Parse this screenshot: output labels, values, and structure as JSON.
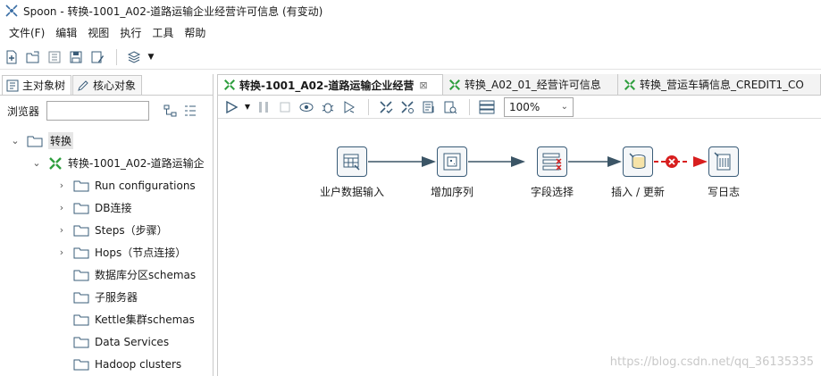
{
  "window": {
    "title": "Spoon - 转换-1001_A02-道路运输企业经营许可信息 (有变动)"
  },
  "menu": [
    "文件(F)",
    "编辑",
    "视图",
    "执行",
    "工具",
    "帮助"
  ],
  "main_toolbar": {
    "icons": [
      "new-file-icon",
      "open-folder-icon",
      "explore-repository-icon",
      "save-icon",
      "save-as-icon",
      "perspective-layers-icon"
    ]
  },
  "left_panel": {
    "tabs": [
      {
        "label": "主对象树",
        "icon": "tree-icon",
        "active": true
      },
      {
        "label": "核心对象",
        "icon": "pencil-icon",
        "active": false
      }
    ],
    "browser_label": "浏览器",
    "search_value": "",
    "tree": [
      {
        "label": "转换",
        "level": 0,
        "expanded": true,
        "icon": "folder-icon",
        "selected": true
      },
      {
        "label": "转换-1001_A02-道路运输企",
        "level": 1,
        "expanded": true,
        "icon": "transformation-icon"
      },
      {
        "label": "Run configurations",
        "level": 2,
        "expandable": true,
        "icon": "folder-icon"
      },
      {
        "label": "DB连接",
        "level": 2,
        "expandable": true,
        "icon": "folder-icon"
      },
      {
        "label": "Steps（步骤）",
        "level": 2,
        "expandable": true,
        "icon": "folder-icon"
      },
      {
        "label": "Hops（节点连接）",
        "level": 2,
        "expandable": true,
        "icon": "folder-icon"
      },
      {
        "label": "数据库分区schemas",
        "level": 2,
        "expandable": false,
        "icon": "folder-icon"
      },
      {
        "label": "子服务器",
        "level": 2,
        "expandable": false,
        "icon": "folder-icon"
      },
      {
        "label": "Kettle集群schemas",
        "level": 2,
        "expandable": false,
        "icon": "folder-icon"
      },
      {
        "label": "Data Services",
        "level": 2,
        "expandable": false,
        "icon": "folder-icon"
      },
      {
        "label": "Hadoop clusters",
        "level": 2,
        "expandable": false,
        "icon": "folder-icon"
      }
    ]
  },
  "editor": {
    "tabs": [
      {
        "label": "转换-1001_A02-道路运输企业经营",
        "active": true,
        "closable": true
      },
      {
        "label": "转换_A02_01_经营许可信息",
        "active": false
      },
      {
        "label": "转换_营运车辆信息_CREDIT1_CO",
        "active": false
      }
    ],
    "zoom": "100%",
    "steps": [
      {
        "label": "业户数据输入",
        "icon": "table-input-icon"
      },
      {
        "label": "增加序列",
        "icon": "add-sequence-icon"
      },
      {
        "label": "字段选择",
        "icon": "select-values-icon"
      },
      {
        "label": "插入 / 更新",
        "icon": "insert-update-icon"
      },
      {
        "label": "写日志",
        "icon": "write-log-icon"
      }
    ]
  },
  "colors": {
    "hop": "#3b5566",
    "error_hop": "#d81e1e",
    "step_border": "#3a5c78",
    "green_icon": "#2e9e3e"
  },
  "watermark": "https://blog.csdn.net/qq_36135335"
}
